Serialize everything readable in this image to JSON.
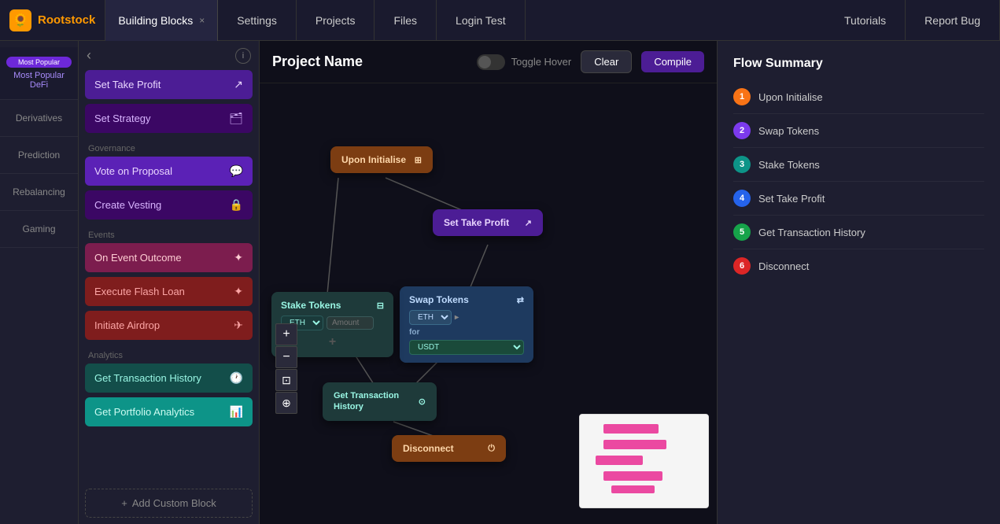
{
  "nav": {
    "logo": "🌻",
    "logo_text": "Rootstock",
    "building_blocks_tab": "Building Blocks",
    "close_icon": "×",
    "tabs": [
      {
        "label": "Settings"
      },
      {
        "label": "Projects"
      },
      {
        "label": "Files"
      },
      {
        "label": "Login Test",
        "active": true
      },
      {
        "label": "Tutorials"
      },
      {
        "label": "Report Bug"
      }
    ]
  },
  "sidebar_categories": [
    {
      "label": "Most Popular DeFi",
      "active": true
    },
    {
      "label": "Derivatives"
    },
    {
      "label": "Prediction"
    },
    {
      "label": "Rebalancing"
    },
    {
      "label": "Gaming"
    }
  ],
  "sidebar_blocks": {
    "collapse_arrow": "‹",
    "info_icon": "i",
    "sections": [
      {
        "label": "",
        "blocks": [
          {
            "label": "Set Take Profit",
            "icon": "↗",
            "style": "purple"
          },
          {
            "label": "Set Strategy",
            "icon": "🗂",
            "style": "dark-purple"
          }
        ]
      },
      {
        "label": "Governance",
        "blocks": [
          {
            "label": "Vote on Proposal",
            "icon": "💬",
            "style": "purple-light"
          },
          {
            "label": "Create Vesting",
            "icon": "🔒",
            "style": "dark-purple"
          }
        ]
      },
      {
        "label": "Events",
        "blocks": [
          {
            "label": "On Event Outcome",
            "icon": "⚡",
            "style": "red-purple"
          },
          {
            "label": "Execute Flash Loan",
            "icon": "⚡",
            "style": "red"
          },
          {
            "label": "Initiate Airdrop",
            "icon": "✈",
            "style": "red"
          }
        ]
      },
      {
        "label": "Analytics",
        "blocks": [
          {
            "label": "Get Transaction History",
            "icon": "🕐",
            "style": "teal"
          },
          {
            "label": "Get Portfolio Analytics",
            "icon": "📊",
            "style": "teal-light"
          }
        ]
      }
    ],
    "add_custom_label": "Add Custom Block",
    "add_icon": "+"
  },
  "canvas": {
    "project_name": "Project Name",
    "toggle_hover_label": "Toggle Hover",
    "clear_label": "Clear",
    "compile_label": "Compile"
  },
  "flow_nodes": {
    "upon_initialise": "Upon Initialise",
    "set_take_profit": "Set Take Profit",
    "swap_tokens": "Swap Tokens",
    "eth_label": "ETH",
    "for_label": "for",
    "usdt_label": "USDT",
    "stake_tokens": "Stake Tokens",
    "amount_placeholder": "Amount",
    "get_transaction_history": "Get Transaction History",
    "disconnect": "Disconnect"
  },
  "flow_summary": {
    "title": "Flow Summary",
    "items": [
      {
        "num": "1",
        "label": "Upon Initialise",
        "color": "orange"
      },
      {
        "num": "2",
        "label": "Swap Tokens",
        "color": "purple"
      },
      {
        "num": "3",
        "label": "Stake Tokens",
        "color": "teal"
      },
      {
        "num": "4",
        "label": "Set Take Profit",
        "color": "blue"
      },
      {
        "num": "5",
        "label": "Get Transaction History",
        "color": "green"
      },
      {
        "num": "6",
        "label": "Disconnect",
        "color": "red"
      }
    ]
  },
  "zoom": {
    "zoom_in": "+",
    "zoom_out": "−",
    "fit": "⊡",
    "reset": "⊕"
  }
}
